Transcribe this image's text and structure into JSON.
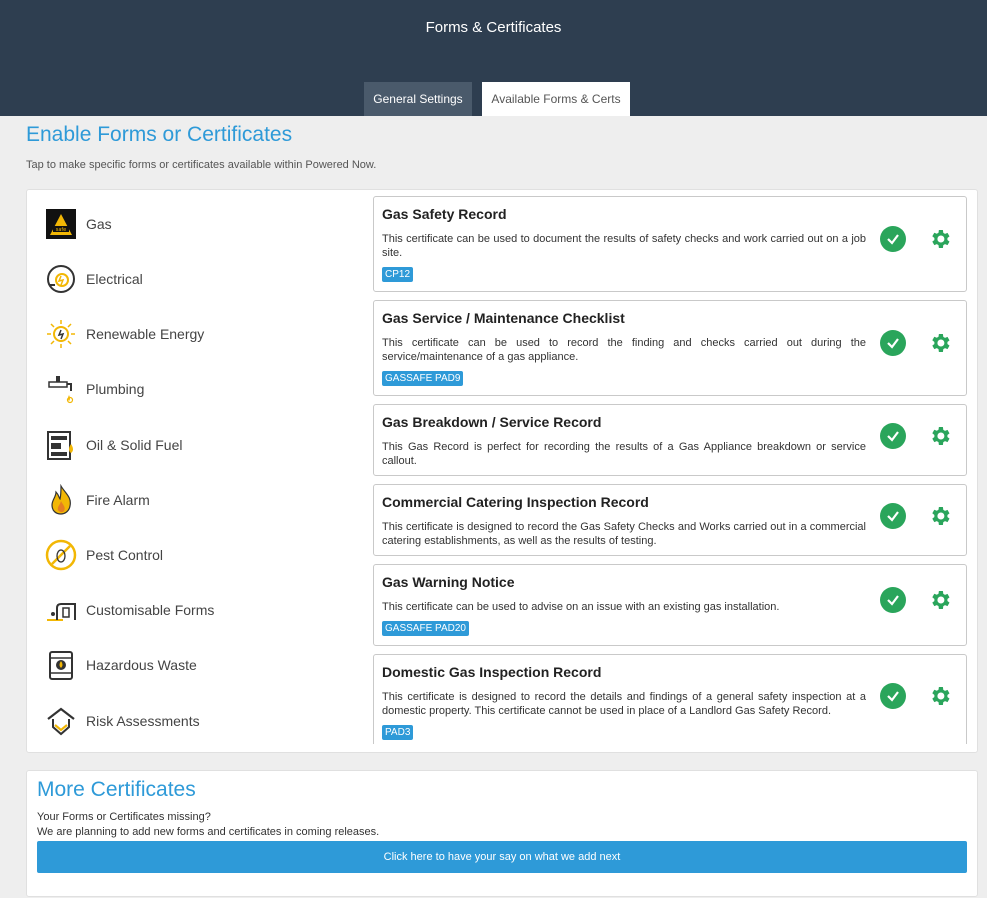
{
  "header": {
    "title": "Forms & Certificates",
    "tabs": [
      {
        "label": "General Settings",
        "active": false
      },
      {
        "label": "Available Forms & Certs",
        "active": true
      }
    ]
  },
  "section": {
    "title": "Enable Forms or Certificates",
    "subtitle": "Tap to make specific forms or certificates available within Powered Now."
  },
  "categories": [
    {
      "label": "Gas",
      "icon": "gas-safe-icon"
    },
    {
      "label": "Electrical",
      "icon": "electrical-plug-icon"
    },
    {
      "label": "Renewable Energy",
      "icon": "solar-icon"
    },
    {
      "label": "Plumbing",
      "icon": "tap-icon"
    },
    {
      "label": "Oil & Solid Fuel",
      "icon": "oil-tank-icon"
    },
    {
      "label": "Fire Alarm",
      "icon": "flame-icon"
    },
    {
      "label": "Pest Control",
      "icon": "no-pest-icon"
    },
    {
      "label": "Customisable Forms",
      "icon": "custom-form-icon"
    },
    {
      "label": "Hazardous Waste",
      "icon": "hazard-barrel-icon"
    },
    {
      "label": "Risk Assessments",
      "icon": "house-shield-icon"
    }
  ],
  "certificates": [
    {
      "title": "Gas Safety Record",
      "description": "This certificate can be used to document the results of safety checks and work carried out on a job site.",
      "tag": "CP12"
    },
    {
      "title": "Gas Service / Maintenance Checklist",
      "description": "This certificate can be used to record the finding and checks carried out during the service/maintenance of a gas appliance.",
      "tag": "GASSAFE PAD9"
    },
    {
      "title": "Gas Breakdown / Service Record",
      "description": "This Gas Record is perfect for recording the results of a Gas Appliance breakdown or service callout.",
      "tag": ""
    },
    {
      "title": "Commercial Catering Inspection Record",
      "description": "This certificate is designed to record the Gas Safety Checks and Works carried out in a commercial catering establishments, as well as the results of testing.",
      "tag": ""
    },
    {
      "title": "Gas Warning Notice",
      "description": "This certificate can be used to advise on an issue with an existing gas installation.",
      "tag": "GASSAFE PAD20"
    },
    {
      "title": "Domestic Gas Inspection Record",
      "description": "This certificate is designed to record the details and findings of a general safety inspection at a domestic property. This certificate cannot be used in place of a Landlord Gas Safety Record.",
      "tag": "PAD3"
    }
  ],
  "more": {
    "title": "More Certificates",
    "line1": "Your Forms or Certificates missing?",
    "line2": "We are planning to add new forms and certificates in coming releases.",
    "button": "Click here to have your say on what we add next"
  },
  "colors": {
    "header_bg": "#2e3e50",
    "accent": "#2e9ad8",
    "enabled_green": "#2aa55b",
    "icon_yellow": "#f2b705"
  }
}
